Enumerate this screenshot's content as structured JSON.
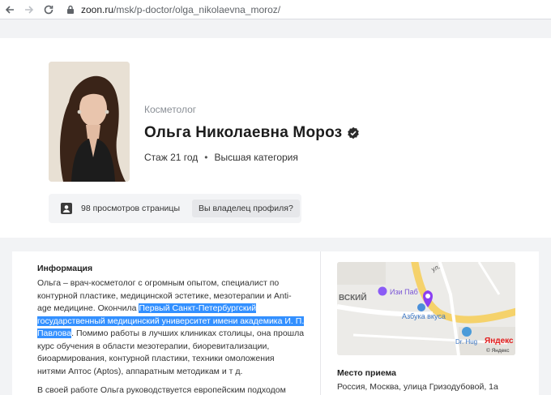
{
  "browser": {
    "url_host": "zoon.ru",
    "url_path": "/msk/p-doctor/olga_nikolaevna_moroz/"
  },
  "profile": {
    "profession": "Косметолог",
    "name": "Ольга Николаевна Мороз",
    "experience": "Стаж 21 год",
    "category": "Высшая категория",
    "separator": "•",
    "views": "98 просмотров страницы",
    "owner_button": "Вы владелец профиля?"
  },
  "info": {
    "title": "Информация",
    "text_before": "Ольга – врач-косметолог с огромным опытом, специалист по контурной пластике, медицинской эстетике, мезотерапии и Anti-age медицине. Окончила ",
    "text_highlight": "Первый Санкт-Петербургский государственный медицинский университет имени академика И. П. Павлова",
    "text_after": ". Помимо работы в лучших клиниках столицы, она прошла курс обучения в области мезотерапии, биоревитализации, биоармирования, контурной пластики, техники омоложения нитями Аптос (Aptos), аппаратным методикам и т д.",
    "text_next": "В своей работе Ольга руководствуется европейским подходом"
  },
  "map": {
    "label_street": "ул.",
    "label_district": "ВСКИЙ",
    "label_poi1": "Изи Паб",
    "label_poi2": "Азбука вкуса",
    "label_poi3": "Dr. Hug",
    "brand": "Яндекс",
    "copyright": "© Яндекс"
  },
  "place": {
    "title": "Место приема",
    "address": "Россия, Москва, улица Гризодубовой, 1а"
  },
  "colors": {
    "highlight": "#3390ff",
    "map_pin": "#8b3ff2",
    "map_road": "#f5d26b"
  }
}
